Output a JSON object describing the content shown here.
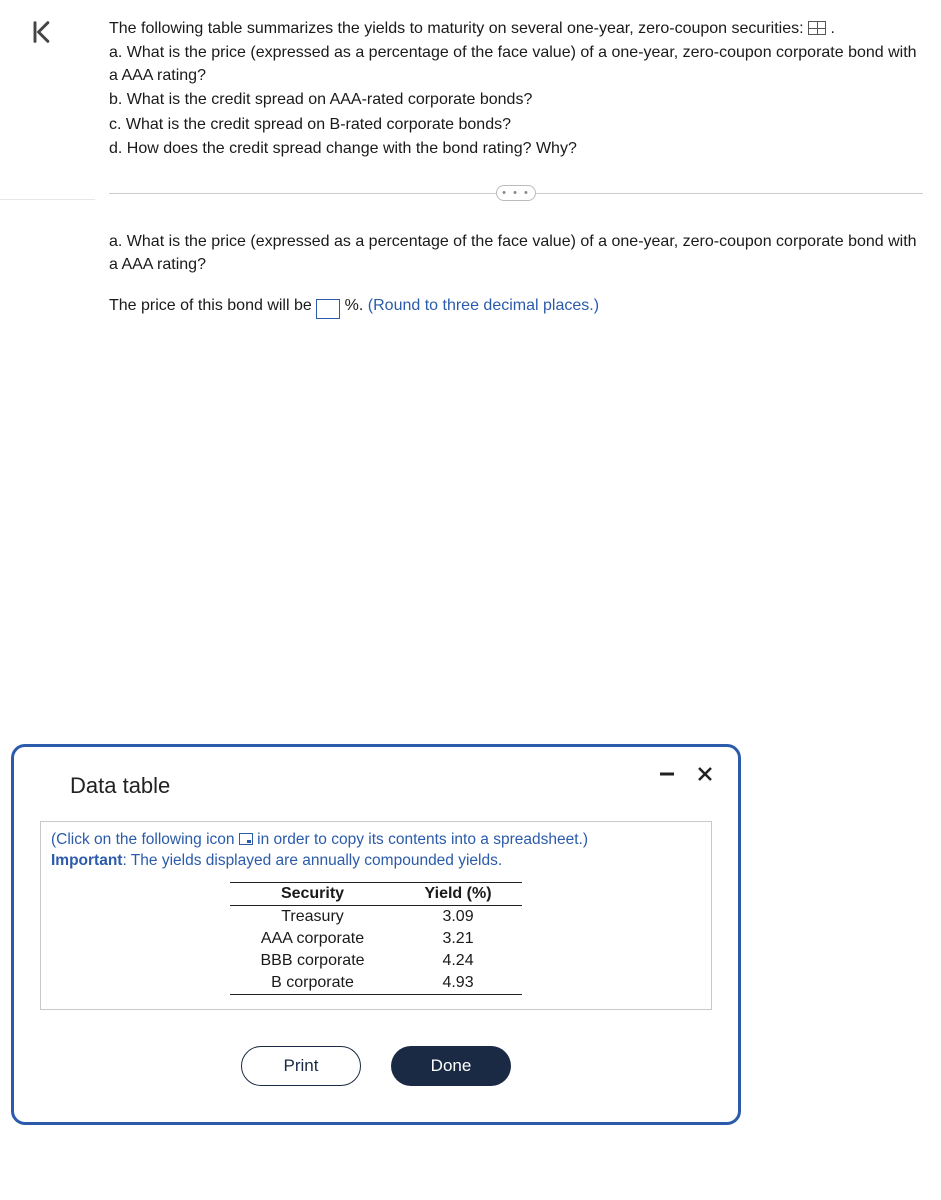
{
  "question": {
    "intro_pre": "The following table summarizes the yields to maturity on several one-year, zero-coupon securities: ",
    "intro_post": " .",
    "a": "a. What is the price (expressed as a percentage of the face value) of a one-year, zero-coupon corporate bond with a AAA rating?",
    "b": "b. What is the credit spread on AAA-rated corporate bonds?",
    "c": "c. What is the credit spread on B-rated corporate bonds?",
    "d": "d. How does the credit spread change with the bond rating? Why?"
  },
  "ellipsis": "…",
  "answer": {
    "a_prompt": "a. What is the price (expressed as a percentage of the face value) of a one-year, zero-coupon corporate bond with a AAA rating?",
    "line_pre": "The price of this bond will be ",
    "input_value": "",
    "line_post": "%. ",
    "hint": "(Round to three decimal places.)"
  },
  "modal": {
    "title": "Data table",
    "instr_pre": "(Click on the following icon ",
    "instr_post": " in order to copy its contents into a spreadsheet.)",
    "important_label": "Important",
    "important_text": ": The yields displayed are annually compounded yields.",
    "headers": {
      "security": "Security",
      "yield": "Yield (%)"
    },
    "rows": [
      {
        "security": "Treasury",
        "yield": "3.09"
      },
      {
        "security": "AAA corporate",
        "yield": "3.21"
      },
      {
        "security": "BBB corporate",
        "yield": "4.24"
      },
      {
        "security": "B corporate",
        "yield": "4.93"
      }
    ],
    "print": "Print",
    "done": "Done"
  },
  "chart_data": {
    "type": "table",
    "title": "Yields to maturity on one-year zero-coupon securities",
    "columns": [
      "Security",
      "Yield (%)"
    ],
    "rows": [
      [
        "Treasury",
        3.09
      ],
      [
        "AAA corporate",
        3.21
      ],
      [
        "BBB corporate",
        4.24
      ],
      [
        "B corporate",
        4.93
      ]
    ],
    "note": "Yields are annually compounded"
  }
}
